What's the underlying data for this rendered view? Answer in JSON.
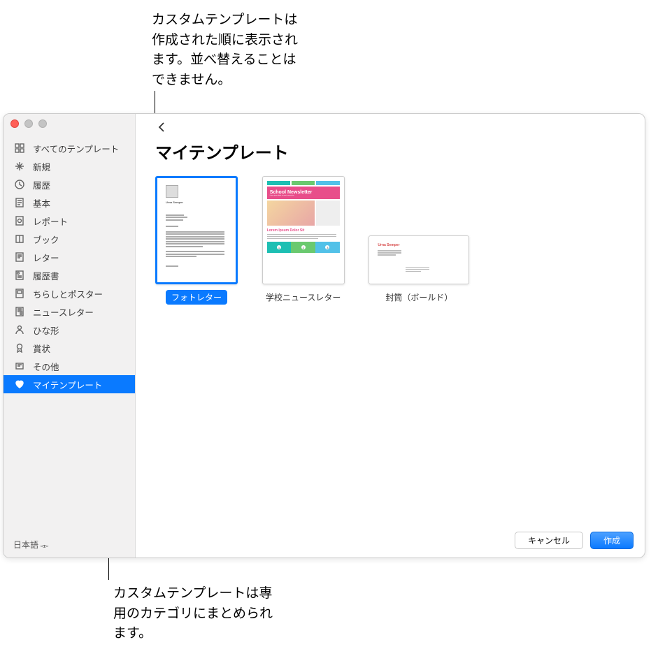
{
  "callouts": {
    "top": "カスタムテンプレートは作成された順に表示されます。並べ替えることはできません。",
    "bottom": "カスタムテンプレートは専用のカテゴリにまとめられます。"
  },
  "sidebar": {
    "items": [
      {
        "label": "すべてのテンプレート",
        "icon": "grid"
      },
      {
        "label": "新規",
        "icon": "sparkle"
      },
      {
        "label": "履歴",
        "icon": "clock"
      },
      {
        "label": "基本",
        "icon": "doc"
      },
      {
        "label": "レポート",
        "icon": "report"
      },
      {
        "label": "ブック",
        "icon": "book"
      },
      {
        "label": "レター",
        "icon": "letter"
      },
      {
        "label": "履歴書",
        "icon": "resume"
      },
      {
        "label": "ちらしとポスター",
        "icon": "poster"
      },
      {
        "label": "ニュースレター",
        "icon": "news"
      },
      {
        "label": "ひな形",
        "icon": "person"
      },
      {
        "label": "賞状",
        "icon": "award"
      },
      {
        "label": "その他",
        "icon": "misc"
      },
      {
        "label": "マイテンプレート",
        "icon": "heart",
        "selected": true
      }
    ],
    "language": "日本語"
  },
  "main": {
    "title": "マイテンプレート",
    "templates": [
      {
        "label": "フォトレター",
        "selected": true,
        "thumb": {
          "name": "Urna Semper"
        }
      },
      {
        "label": "学校ニュースレター",
        "thumb": {
          "banner": "School Newsletter",
          "heading": "Lorem Ipsum Dolor Sit"
        }
      },
      {
        "label": "封筒（ボールド）",
        "thumb": {
          "name": "Urna Semper"
        }
      }
    ]
  },
  "footer": {
    "cancel": "キャンセル",
    "create": "作成"
  }
}
